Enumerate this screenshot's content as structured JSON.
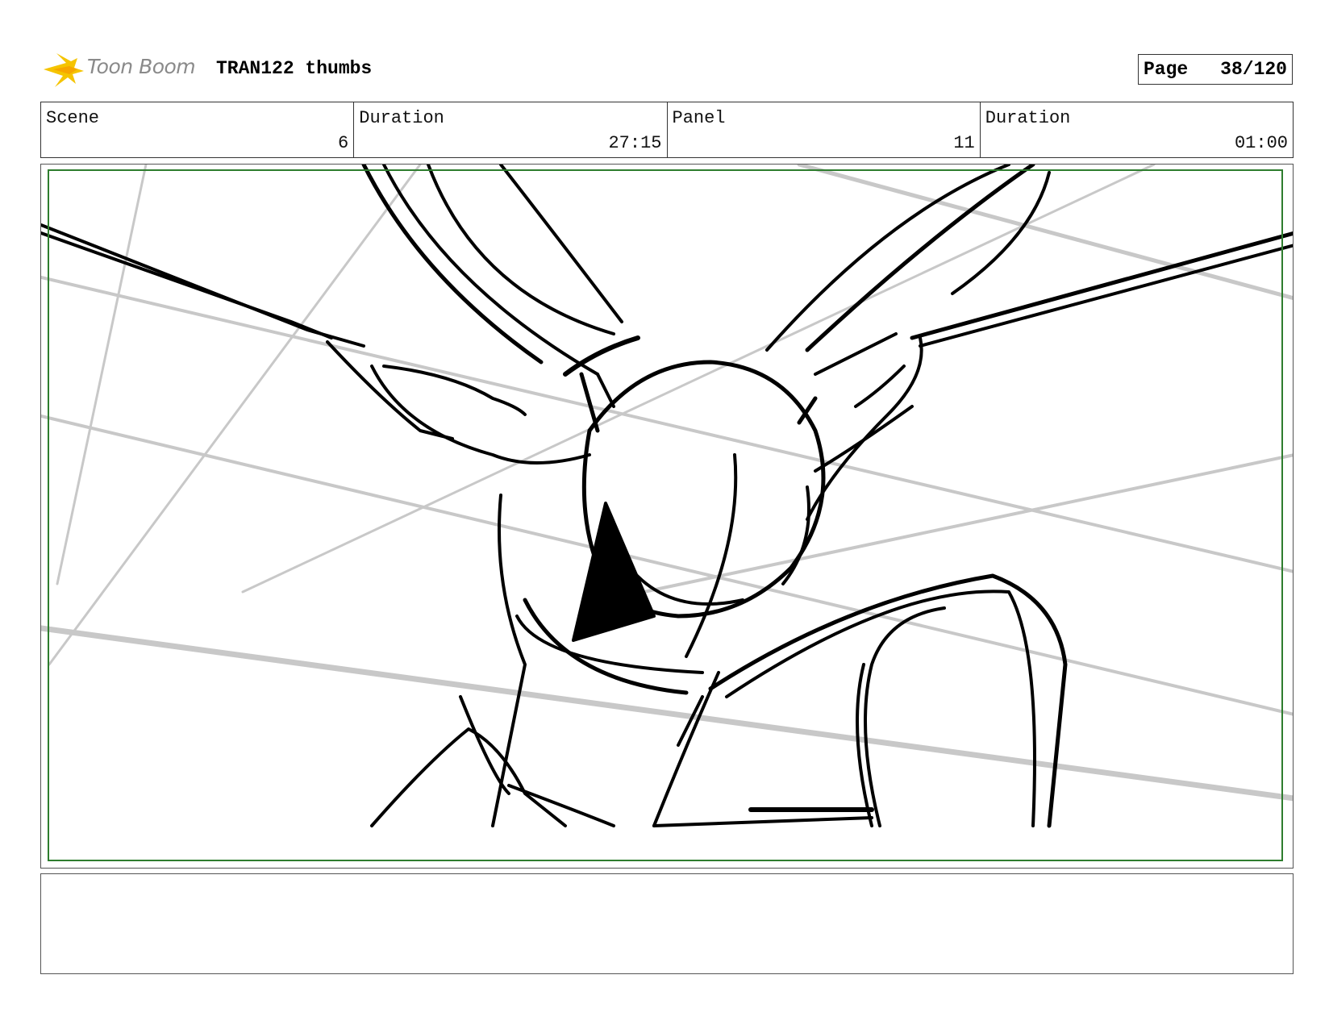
{
  "header": {
    "logo_text": "Toon Boom",
    "project_title": "TRAN122 thumbs",
    "page_label": "Page",
    "page_value": "38/120"
  },
  "info": [
    {
      "label": "Scene",
      "value": "6"
    },
    {
      "label": "Duration",
      "value": "27:15"
    },
    {
      "label": "Panel",
      "value": "11"
    },
    {
      "label": "Duration",
      "value": "01:00"
    }
  ],
  "notes": {
    "text": ""
  },
  "colors": {
    "safe_frame": "#2e7d2e",
    "logo_yellow": "#f5c400",
    "sketch": "#000000",
    "guide_lines": "#c8c8c8"
  }
}
